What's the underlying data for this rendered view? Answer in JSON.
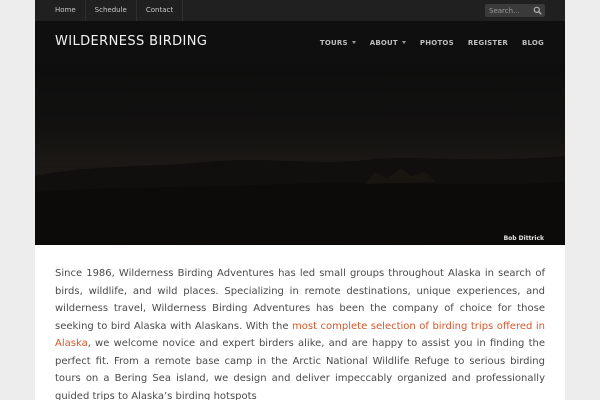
{
  "topbar": {
    "nav": [
      "Home",
      "Schedule",
      "Contact"
    ],
    "search_placeholder": "Search..."
  },
  "header": {
    "site_title": "WILDERNESS BIRDING",
    "nav": [
      {
        "label": "TOURS",
        "dropdown": true
      },
      {
        "label": "ABOUT",
        "dropdown": true
      },
      {
        "label": "PHOTOS",
        "dropdown": false
      },
      {
        "label": "REGISTER",
        "dropdown": false
      },
      {
        "label": "BLOG",
        "dropdown": false
      }
    ]
  },
  "hero": {
    "photo_credit": "Bob Dittrick"
  },
  "content": {
    "intro_before_link": "Since 1986, Wilderness Birding Adventures has led small groups throughout Alaska in search of birds, wildlife, and wild places. Specializing in remote destinations, unique experiences, and wilderness travel, Wilderness Birding Adventures has been the company of choice for those seeking to bird Alaska with Alaskans. With the ",
    "intro_link": "most complete selection of birding trips offered in Alaska",
    "intro_after_link": ", we welcome novice and expert birders alike, and are happy to assist you in finding the perfect fit. From a remote base camp in the Arctic National Wildlife Refuge to serious birding tours on a Bering Sea island, we design and deliver impeccably organized and professionally guided trips to Alaska’s birding hotspots"
  },
  "colors": {
    "page_background": "#ededed",
    "topbar": "#202020",
    "header": "#0f0f0f",
    "link_accent": "#d4572a",
    "body_text": "#4a4a4a"
  },
  "icons": {
    "search": "search-icon"
  }
}
